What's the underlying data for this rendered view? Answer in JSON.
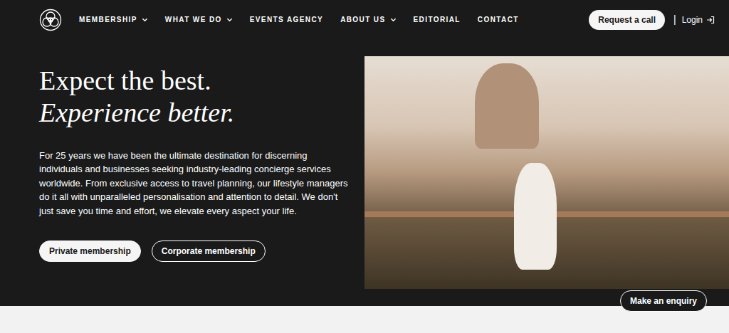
{
  "nav": {
    "items": [
      {
        "label": "MEMBERSHIP",
        "kind": "dropdown"
      },
      {
        "label": "WHAT WE DO",
        "kind": "dropdown"
      },
      {
        "label": "EVENTS AGENCY",
        "kind": "link"
      },
      {
        "label": "ABOUT US",
        "kind": "dropdown"
      },
      {
        "label": "EDITORIAL",
        "kind": "link"
      },
      {
        "label": "CONTACT",
        "kind": "link"
      }
    ]
  },
  "actions": {
    "request_call": "Request a call",
    "separator": "|",
    "login": "Login"
  },
  "hero": {
    "headline": "Expect the best.",
    "subheadline": "Experience better.",
    "body": "For 25 years we have been the ultimate destination for discerning individuals and businesses seeking industry-leading concierge services worldwide. From exclusive access to travel planning, our lifestyle managers do it all with unparalleled personalisation and attention to detail. We don't just save you time and effort, we elevate every aspect your life.",
    "buttons": [
      {
        "label": "Private membership",
        "kind": "filled"
      },
      {
        "label": "Corporate membership",
        "kind": "outline"
      }
    ]
  },
  "enquiry": "Make an enquiry"
}
